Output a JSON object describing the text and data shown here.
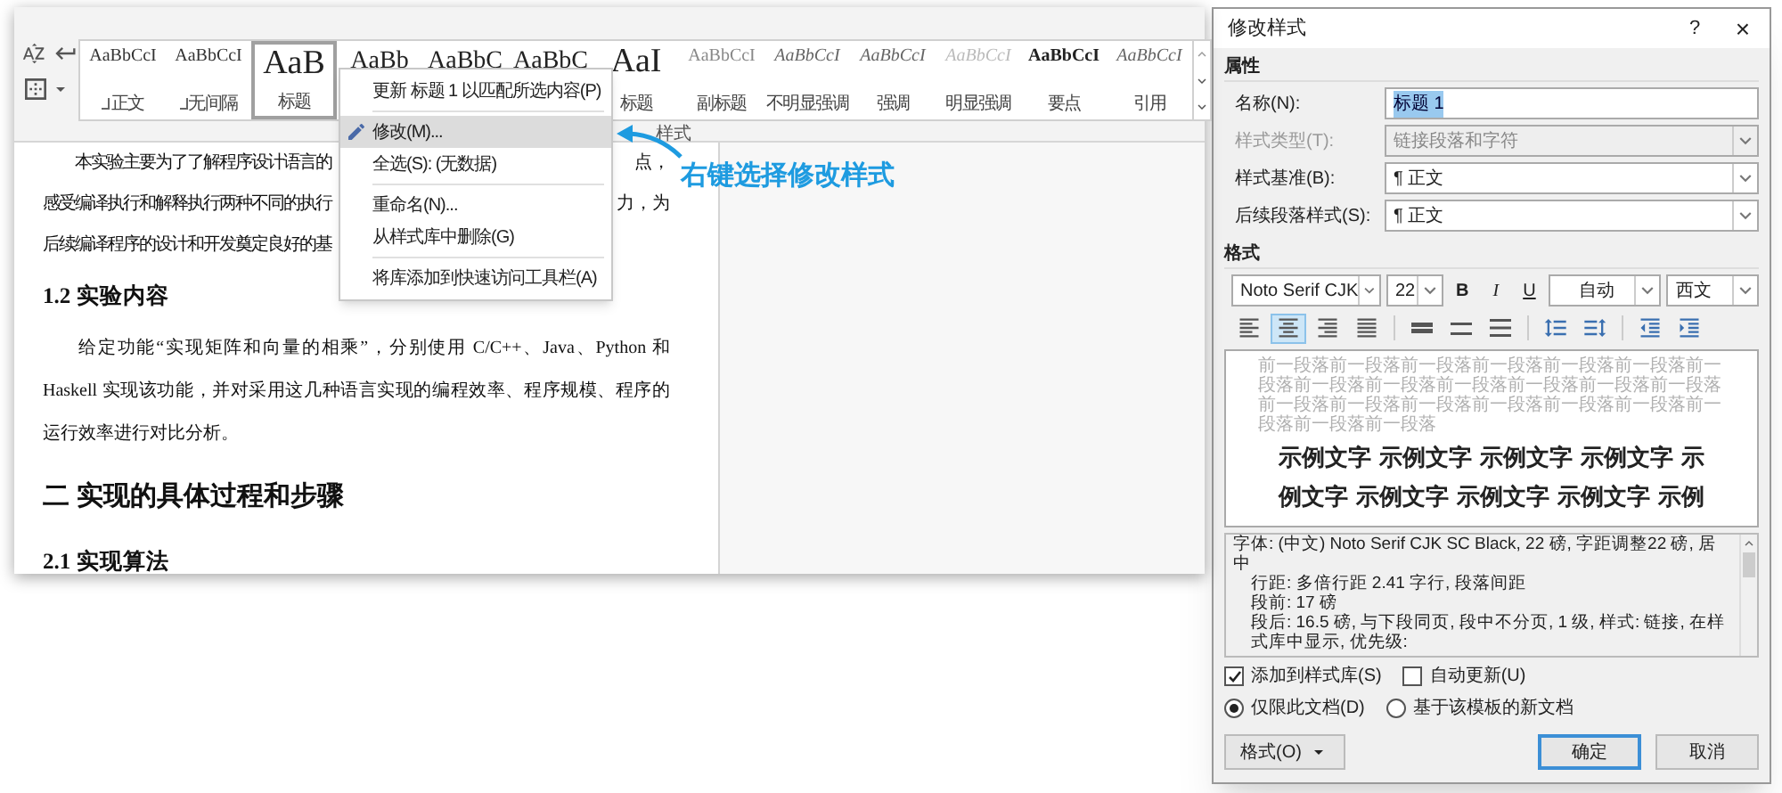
{
  "word": {
    "ribbon": {
      "tools": [
        {
          "kind": "sort"
        },
        {
          "kind": "return"
        },
        {
          "kind": "borders"
        }
      ],
      "styles": [
        {
          "preview": "AaBbCcI",
          "label": "正文",
          "kind": "plain",
          "mark": true,
          "selected": false
        },
        {
          "preview": "AaBbCcI",
          "label": "无间隔",
          "kind": "plain",
          "mark": true,
          "selected": false
        },
        {
          "preview": "AaB",
          "label": "标题",
          "kind": "large",
          "mark": false,
          "selected": true
        },
        {
          "preview": "AaBb",
          "kind": "heading",
          "mark": false,
          "selected": false
        },
        {
          "preview": "AaBbC",
          "kind": "heading",
          "mark": false,
          "selected": false
        },
        {
          "preview": "AaBbC",
          "kind": "heading",
          "mark": false,
          "selected": false
        },
        {
          "preview": "AaI",
          "label": "标题",
          "kind": "large",
          "mark": false,
          "selected": false
        },
        {
          "preview": "AaBbCcI",
          "label": "副标题",
          "kind": "subtle",
          "mark": false,
          "selected": false
        },
        {
          "preview": "AaBbCcI",
          "label": "不明显强调",
          "kind": "italic",
          "mark": false,
          "selected": false
        },
        {
          "preview": "AaBbCcI",
          "label": "强调",
          "kind": "italic",
          "mark": false,
          "selected": false
        },
        {
          "preview": "AaBbCcI",
          "label": "明显强调",
          "kind": "faint",
          "mark": false,
          "selected": false
        },
        {
          "preview": "AaBbCcI",
          "label": "要点",
          "kind": "bold",
          "mark": false,
          "selected": false
        },
        {
          "preview": "AaBbCcI",
          "label": "引用",
          "kind": "italic",
          "mark": false,
          "selected": false
        }
      ],
      "group_label": "样式"
    },
    "document": {
      "split_lines": [
        {
          "left": "本实验主要为了了解程序设计语言的",
          "right": "点，"
        },
        {
          "left": "感受编译执行和解释执行两种不同的执行",
          "right": "力，为"
        },
        {
          "left": "后续编译程序的设计和开发奠定良好的基"
        }
      ],
      "blocks": [
        {
          "kind": "h2",
          "text": "1.2  实验内容"
        },
        {
          "kind": "body",
          "text": "给定功能“实现矩阵和向量的相乘”，分别使用 C/C++、Java、Python 和 Haskell 实现该功能，并对采用这几种语言实现的编程效率、程序规模、程序的运行效率进行对比分析。"
        },
        {
          "kind": "h1",
          "text": "二  实现的具体过程和步骤"
        },
        {
          "kind": "h2",
          "text": "2.1  实现算法"
        }
      ]
    },
    "context_menu": [
      {
        "label": "更新 标题 1 以匹配所选内容(P)",
        "icon": false,
        "separator_before": false,
        "selected": false
      },
      {
        "label": "修改(M)...",
        "icon": true,
        "separator_before": true,
        "selected": true
      },
      {
        "label": "全选(S): (无数据)",
        "icon": false,
        "separator_before": false,
        "selected": false
      },
      {
        "label": "重命名(N)...",
        "icon": false,
        "separator_before": true,
        "selected": false
      },
      {
        "label": "从样式库中删除(G)",
        "icon": false,
        "separator_before": false,
        "selected": false
      },
      {
        "label": "将库添加到快速访问工具栏(A)",
        "icon": false,
        "separator_before": true,
        "selected": false
      }
    ]
  },
  "annotation": {
    "text": "右键选择修改样式"
  },
  "dialog": {
    "title": "修改样式",
    "help": "?",
    "close": "×",
    "properties": {
      "heading": "属性",
      "rows": [
        {
          "label": "名称(N):",
          "value": "标题 1",
          "kind": "input",
          "highlighted": true,
          "disabled": false
        },
        {
          "label": "样式类型(T):",
          "value": "链接段落和字符",
          "kind": "select",
          "highlighted": false,
          "disabled": true
        },
        {
          "label": "样式基准(B):",
          "value": "¶ 正文",
          "kind": "select",
          "highlighted": false,
          "disabled": false
        },
        {
          "label": "后续段落样式(S):",
          "value": "¶ 正文",
          "kind": "select",
          "highlighted": false,
          "disabled": false
        }
      ]
    },
    "format": {
      "heading": "格式",
      "font": "Noto Serif CJK",
      "size": "22",
      "bold": "B",
      "italic": "I",
      "underline": "U",
      "font_color": "自动",
      "script": "西文",
      "paragraph_tools": [
        {
          "kind": "align-left",
          "selected": false
        },
        {
          "kind": "align-center",
          "selected": true
        },
        {
          "kind": "align-right",
          "selected": false
        },
        {
          "kind": "align-justify",
          "selected": false
        },
        {
          "kind": "single",
          "selected": false
        },
        {
          "kind": "one-half",
          "selected": false
        },
        {
          "kind": "double",
          "selected": false
        },
        {
          "kind": "space-before",
          "selected": false
        },
        {
          "kind": "space-after",
          "selected": false
        },
        {
          "kind": "indent-decrease",
          "selected": false
        },
        {
          "kind": "indent-increase",
          "selected": false
        }
      ]
    },
    "preview": {
      "previous": "前一段落前一段落前一段落前一段落前一段落前一段落前一段落前一段落前一段落前一段落前一段落前一段落前一段落前一段落前一段落前一段落前一段落前一段落前一段落前一段落前一段落前一段落",
      "samples": [
        "示例文字 示例文字 示例文字 示例文字 示",
        "例文字 示例文字 示例文字 示例文字 示例"
      ]
    },
    "description": [
      "字体: (中文) Noto Serif CJK SC Black, 22 磅, 字距调整22 磅, 居中",
      "行距: 多倍行距 2.41 字行, 段落间距",
      "段前: 17 磅",
      "段后: 16.5 磅, 与下段同页, 段中不分页, 1 级, 样式: 链接, 在样式库中显示, 优先级:"
    ],
    "checkboxes": [
      {
        "label": "添加到样式库(S)",
        "checked": true
      },
      {
        "label": "自动更新(U)",
        "checked": false
      }
    ],
    "radios": [
      {
        "label": "仅限此文档(D)",
        "selected": true
      },
      {
        "label": "基于该模板的新文档",
        "selected": false
      }
    ],
    "format_button": "格式(O)",
    "ok": "确定",
    "cancel": "取消"
  }
}
